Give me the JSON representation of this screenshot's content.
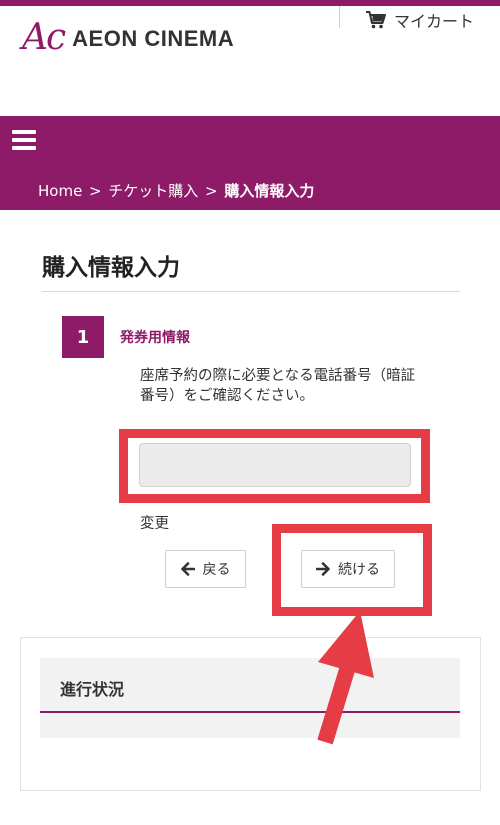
{
  "header": {
    "brand_mark": "Ac",
    "brand_name": "AEON CINEMA",
    "cart_label": "マイカート",
    "cart_icon": "shopping-cart-icon"
  },
  "nav": {
    "menu_icon": "hamburger-menu-icon",
    "breadcrumb": [
      "Home",
      "チケット購入",
      "購入情報入力"
    ],
    "separator": ">"
  },
  "page": {
    "title": "購入情報入力"
  },
  "step": {
    "number": "1",
    "title": "発券用情報",
    "description": "座席予約の際に必要となる電話番号（暗証番号）をご確認ください。",
    "input_value": "",
    "change_label": "変更"
  },
  "buttons": {
    "back_label": "戻る",
    "next_label": "続ける"
  },
  "progress": {
    "title": "進行状況"
  },
  "colors": {
    "brand": "#8e1b68",
    "annotation": "#e53c45"
  }
}
